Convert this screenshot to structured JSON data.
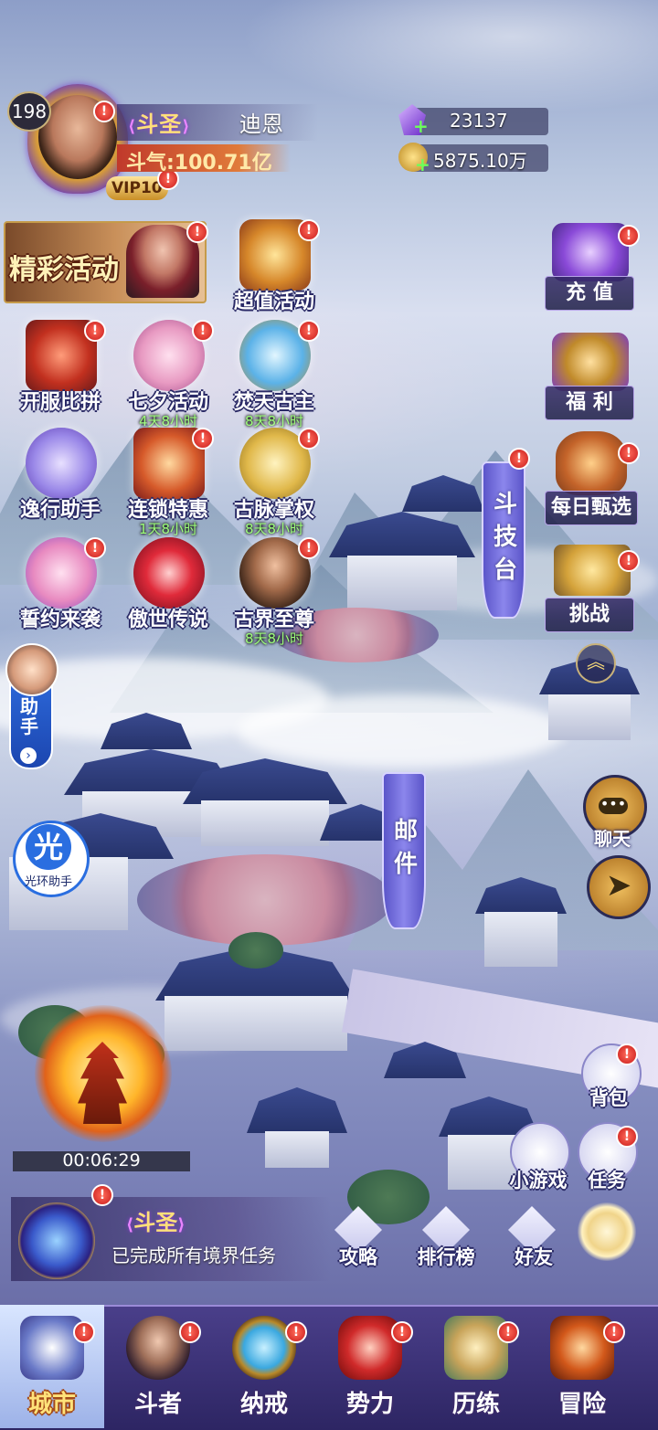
{
  "player": {
    "level": "198",
    "vip": "VIP10",
    "rank_title": "斗圣",
    "name": "迪恩",
    "power": "斗气:100.71亿"
  },
  "currency": {
    "gems": "23137",
    "gold": "5875.10万"
  },
  "banner": {
    "label": "精彩活动"
  },
  "events": [
    {
      "label": "超值活动",
      "timer": ""
    },
    {
      "label": "开服比拼",
      "timer": ""
    },
    {
      "label": "七夕活动",
      "timer": "4天8小时"
    },
    {
      "label": "焚天古主",
      "timer": "8天8小时"
    },
    {
      "label": "逸行助手",
      "timer": ""
    },
    {
      "label": "连锁特惠",
      "timer": "1天8小时"
    },
    {
      "label": "古脉掌权",
      "timer": "8天8小时"
    },
    {
      "label": "誓约来袭",
      "timer": ""
    },
    {
      "label": "傲世传说",
      "timer": ""
    },
    {
      "label": "古界至尊",
      "timer": "8天8小时"
    }
  ],
  "right_menu": {
    "recharge": "充 值",
    "welfare": "福 利",
    "daily": "每日甄选",
    "challenge": "挑战"
  },
  "map_labels": {
    "arena": "斗技台",
    "mail": "邮件"
  },
  "side": {
    "assistant": "助手",
    "halo_char": "光",
    "halo_label": "光环助手",
    "chat": "聊天"
  },
  "countdown": "00:06:29",
  "realm": {
    "title": "斗圣",
    "desc": "已完成所有境界任务"
  },
  "actions": {
    "bag": "背包",
    "minigame": "小游戏",
    "task": "任务",
    "guide": "攻略",
    "ranking": "排行榜",
    "friends": "好友"
  },
  "nav": [
    {
      "label": "城市",
      "active": true
    },
    {
      "label": "斗者",
      "active": false
    },
    {
      "label": "纳戒",
      "active": false
    },
    {
      "label": "势力",
      "active": false
    },
    {
      "label": "历练",
      "active": false
    },
    {
      "label": "冒险",
      "active": false
    }
  ],
  "badge_mark": "!",
  "colors": {
    "accent_gold": "#ffe07a",
    "timer_green": "#9dff7a",
    "nav_bg": "#2d2563",
    "alert_red": "#c81a1a"
  }
}
